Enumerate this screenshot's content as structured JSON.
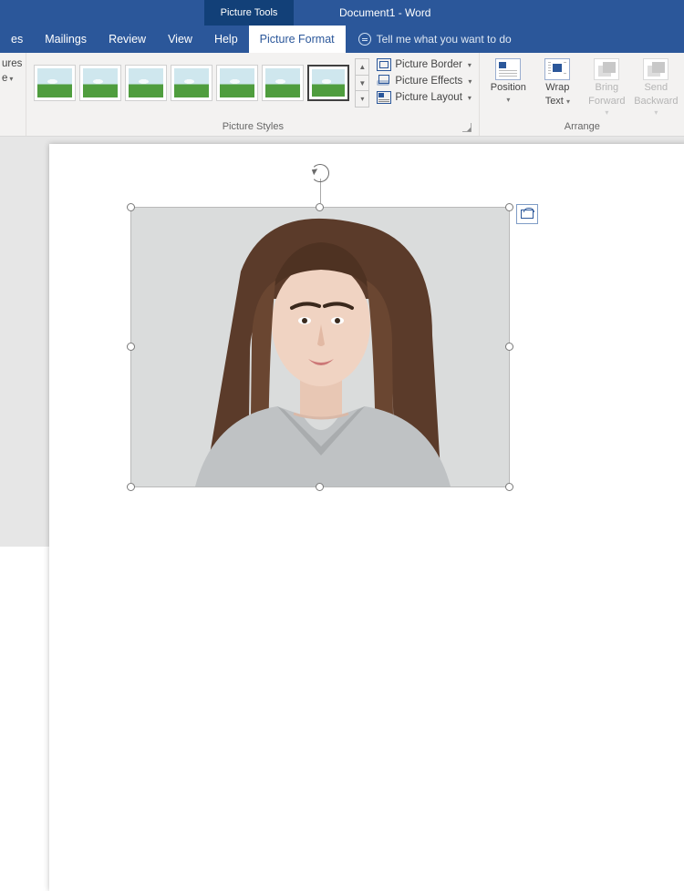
{
  "titlebar": {
    "context_tab": "Picture Tools",
    "document_title": "Document1 - Word"
  },
  "tabs": {
    "items": [
      "es",
      "Mailings",
      "Review",
      "View",
      "Help",
      "Picture Format"
    ],
    "active_index": 5,
    "tell_me_placeholder": "Tell me what you want to do"
  },
  "ribbon": {
    "group_first_stub": {
      "line1": "ures",
      "line2": "e",
      "dropdown": "▾"
    },
    "picture_styles": {
      "label": "Picture Styles",
      "thumb_count": 7,
      "selected_index": 6,
      "options": {
        "border": "Picture Border",
        "effects": "Picture Effects",
        "layout": "Picture Layout"
      }
    },
    "arrange": {
      "label": "Arrange",
      "position": {
        "line1": "Position",
        "drop": "▾"
      },
      "wrap": {
        "line1": "Wrap",
        "line2": "Text",
        "drop": "▾"
      },
      "bring_forward": {
        "line1": "Bring",
        "line2": "Forward",
        "drop": "▾"
      },
      "send_backward": {
        "line1": "Send",
        "line2": "Backward",
        "drop": "▾"
      }
    }
  },
  "canvas": {
    "image_description": "Portrait photo of a young woman with long brown hair, neutral expression, grey v-neck t-shirt, light grey background",
    "selected": true
  }
}
